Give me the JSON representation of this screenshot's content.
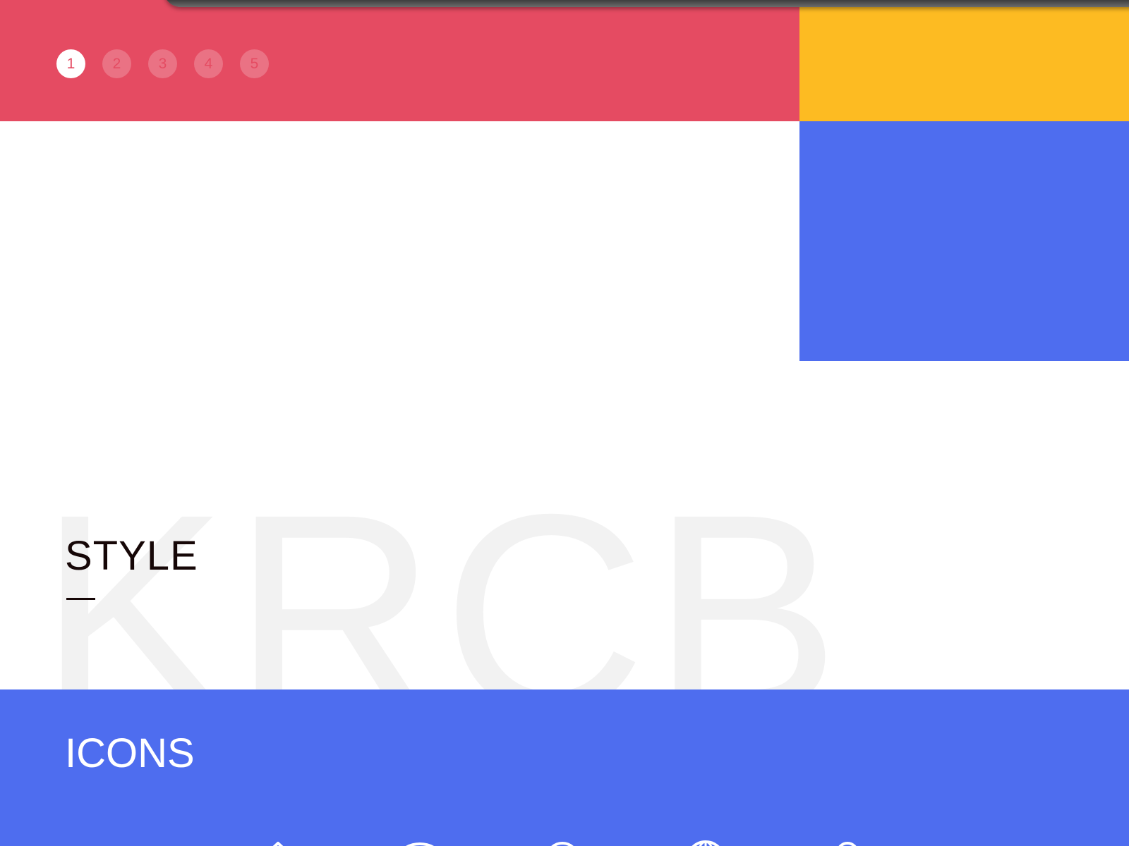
{
  "pager": {
    "items": [
      "1",
      "2",
      "3",
      "4",
      "5"
    ],
    "active_index": 0
  },
  "hero": {
    "watermark": "KRCB"
  },
  "style_section": {
    "title": "STYLE"
  },
  "icons_section": {
    "title": "ICONS",
    "icons": [
      "home-icon",
      "chat-icon",
      "user-icon",
      "globe-icon",
      "location-icon"
    ]
  },
  "colors": {
    "red": "#e54b62",
    "yellow": "#fdbb22",
    "blue": "#4e6def",
    "watermark": "#f2f2f2",
    "text_dark": "#160707"
  }
}
